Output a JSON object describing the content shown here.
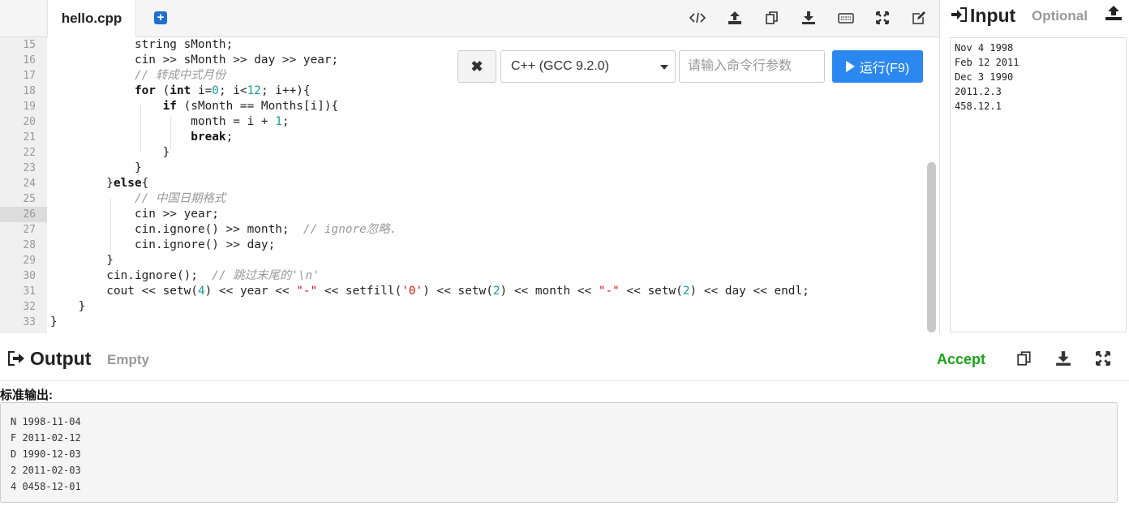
{
  "editor": {
    "file_tab": "hello.cpp",
    "add_tab_label": "+",
    "toolbar_icons": [
      "code-icon",
      "upload-icon",
      "copy-icon",
      "download-icon",
      "keyboard-icon",
      "expand-icon",
      "edit-icon"
    ],
    "line_numbers": [
      "15",
      "16",
      "17",
      "18",
      "19",
      "20",
      "21",
      "22",
      "23",
      "24",
      "25",
      "26",
      "27",
      "28",
      "29",
      "30",
      "31",
      "32",
      "33"
    ],
    "active_line": "26"
  },
  "run_controls": {
    "clear_label": "✖",
    "language": "C++ (GCC 9.2.0)",
    "args_placeholder": "请输入命令行参数",
    "run_label": "运行(F9)"
  },
  "input": {
    "title": "Input",
    "optional_label": "Optional",
    "lines": [
      "Nov 4 1998",
      "Feb 12 2011",
      "Dec 3 1990",
      "2011.2.3",
      "458.12.1"
    ]
  },
  "output": {
    "title": "Output",
    "empty_label": "Empty",
    "accept_label": "Accept",
    "stdout_label": "标准输出:",
    "lines": [
      "N 1998-11-04",
      "F 2011-02-12",
      "D 1990-12-03",
      "2 2011-02-03",
      "4 0458-12-01"
    ]
  },
  "colors": {
    "run_button": "#2b88f0",
    "accept": "#18a418",
    "muted": "#999999"
  }
}
